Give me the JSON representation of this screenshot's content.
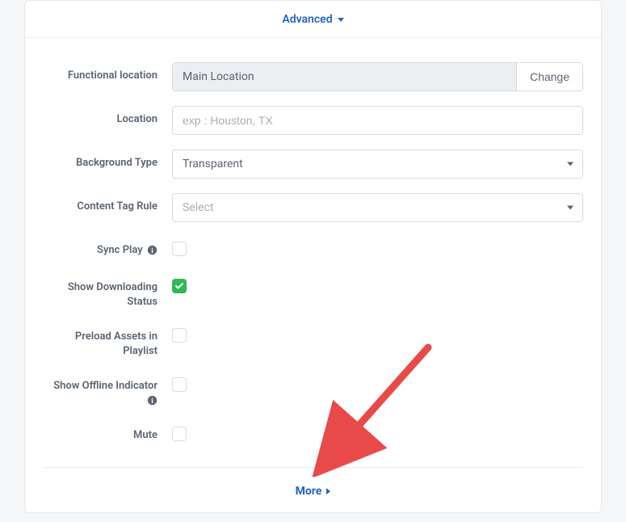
{
  "header": {
    "title": "Advanced"
  },
  "fields": {
    "functional_location": {
      "label": "Functional location",
      "value": "Main Location",
      "change_label": "Change"
    },
    "location": {
      "label": "Location",
      "placeholder": "exp : Houston, TX"
    },
    "background_type": {
      "label": "Background Type",
      "value": "Transparent"
    },
    "content_tag_rule": {
      "label": "Content Tag Rule",
      "placeholder": "Select"
    },
    "sync_play": {
      "label": "Sync Play",
      "checked": false
    },
    "show_downloading_status": {
      "label": "Show Downloading Status",
      "checked": true
    },
    "preload_assets": {
      "label": "Preload Assets in Playlist",
      "checked": false
    },
    "show_offline_indicator": {
      "label": "Show Offline Indicator",
      "checked": false
    },
    "mute": {
      "label": "Mute",
      "checked": false
    }
  },
  "footer": {
    "more_label": "More"
  },
  "colors": {
    "accent": "#2463c2",
    "checked": "#2fb955",
    "arrow": "#e84a4a"
  }
}
